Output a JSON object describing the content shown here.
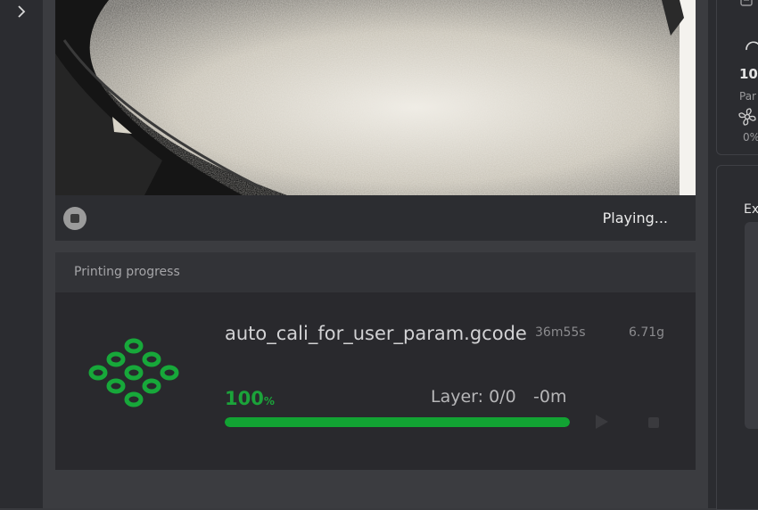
{
  "camera": {
    "status": "Playing..."
  },
  "progress": {
    "title": "Printing progress",
    "file_name": "auto_cali_for_user_param.gcode",
    "time_estimate": "36m55s",
    "weight": "6.71g",
    "percent": "100",
    "percent_sign": "%",
    "percent_fill": 100,
    "layer": "Layer: 0/0",
    "remaining": "-0m"
  },
  "right_panel": {
    "speed_value": "10",
    "part_label": "Par",
    "fan_value": "0%",
    "ext_label": "Ex"
  },
  "colors": {
    "accent": "#12a333",
    "background": "#38393d"
  }
}
